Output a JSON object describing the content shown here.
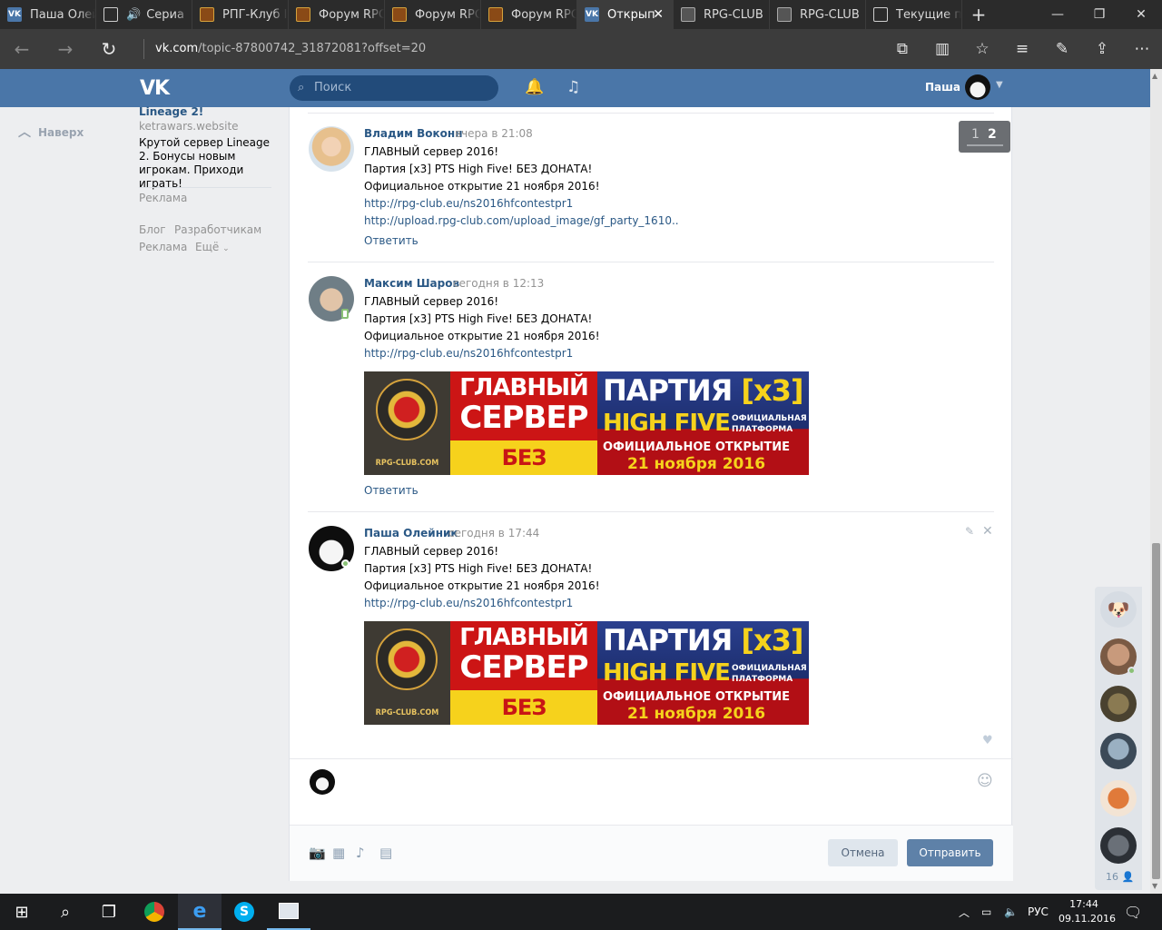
{
  "browser": {
    "tabs": [
      {
        "title": "Паша Олей",
        "icon": "vk-favicon",
        "active": false
      },
      {
        "title": "Сериа",
        "icon": "page-favicon",
        "active": false
      },
      {
        "title": "РПГ-Клуб I",
        "icon": "rpg-favicon",
        "active": false
      },
      {
        "title": "Форум RPC",
        "icon": "rpg-favicon",
        "active": false
      },
      {
        "title": "Форум RPC",
        "icon": "rpg-favicon",
        "active": false
      },
      {
        "title": "Форум RPC",
        "icon": "rpg-favicon",
        "active": false
      },
      {
        "title": "Открып",
        "icon": "vk-favicon",
        "active": true
      },
      {
        "title": "RPG-CLUB",
        "icon": "rpg-favicon",
        "active": false
      },
      {
        "title": "RPG-CLUB",
        "icon": "rpg-favicon",
        "active": false
      },
      {
        "title": "Текущие пс",
        "icon": "page-favicon",
        "active": false
      }
    ],
    "url_domain": "vk.com",
    "url_path": "/topic-87800742_31872081?offset=20"
  },
  "vk": {
    "search_placeholder": "Поиск",
    "user_name": "Паша",
    "logo": "VK",
    "accent": "#4a76a8"
  },
  "left": {
    "back_to_top": "Наверх",
    "ad": {
      "title": "Lineage 2!",
      "domain": "ketrawars.website",
      "text": "Крутой сервер Lineage 2. Бонусы новым игрокам. Приходи играть!",
      "label": "Реклама"
    },
    "footer": {
      "blog": "Блог",
      "developers": "Разработчикам",
      "ads": "Реклама",
      "more": "Ещё"
    }
  },
  "pager": {
    "prev": "1",
    "current": "2"
  },
  "posts": [
    {
      "author": "Владим Воконн",
      "date": "вчера в 21:08",
      "lines": [
        "ГЛАВНЫЙ сервер 2016!",
        "Партия [x3] PTS High Five! БЕЗ ДОНАТА!",
        "Официальное открытие 21 ноября 2016!"
      ],
      "links": [
        "http://rpg-club.eu/ns2016hfcontestpr1",
        "http://upload.rpg-club.com/upload_image/gf_party_1610.."
      ],
      "reply": "Ответить"
    },
    {
      "author": "Максим Шаров",
      "date": "сегодня в 12:13",
      "lines": [
        "ГЛАВНЫЙ сервер 2016!",
        "Партия [x3] PTS High Five! БЕЗ ДОНАТА!",
        "Официальное открытие 21 ноября 2016!"
      ],
      "links": [
        "http://rpg-club.eu/ns2016hfcontestpr1"
      ],
      "reply": "Ответить"
    },
    {
      "author": "Паша Олейник",
      "date": "сегодня в 17:44",
      "lines": [
        "ГЛАВНЫЙ сервер 2016!",
        "Партия [x3] PTS High Five! БЕЗ ДОНАТА!",
        "Официальное открытие 21 ноября 2016!"
      ],
      "links": [
        "http://rpg-club.eu/ns2016hfcontestpr1"
      ]
    }
  ],
  "banner": {
    "site": "RPG-CLUB.COM",
    "line1": "ГЛАВНЫЙ",
    "line2": "СЕРВЕР",
    "line3": "БЕЗ ДОНАТА",
    "party": "ПАРТИЯ",
    "rate": "[x3]",
    "chronicle": "HIGH FIVE",
    "platform_1": "ОФИЦИАЛЬНАЯ",
    "platform_2": "ПЛАТФОРМА",
    "opening": "ОФИЦИАЛЬНОЕ ОТКРЫТИЕ",
    "date": "21 ноября 2016"
  },
  "composer": {
    "cancel": "Отмена",
    "send": "Отправить"
  },
  "friends_widget": {
    "count": "16"
  },
  "taskbar": {
    "lang": "РУС",
    "time": "17:44",
    "date": "09.11.2016"
  }
}
